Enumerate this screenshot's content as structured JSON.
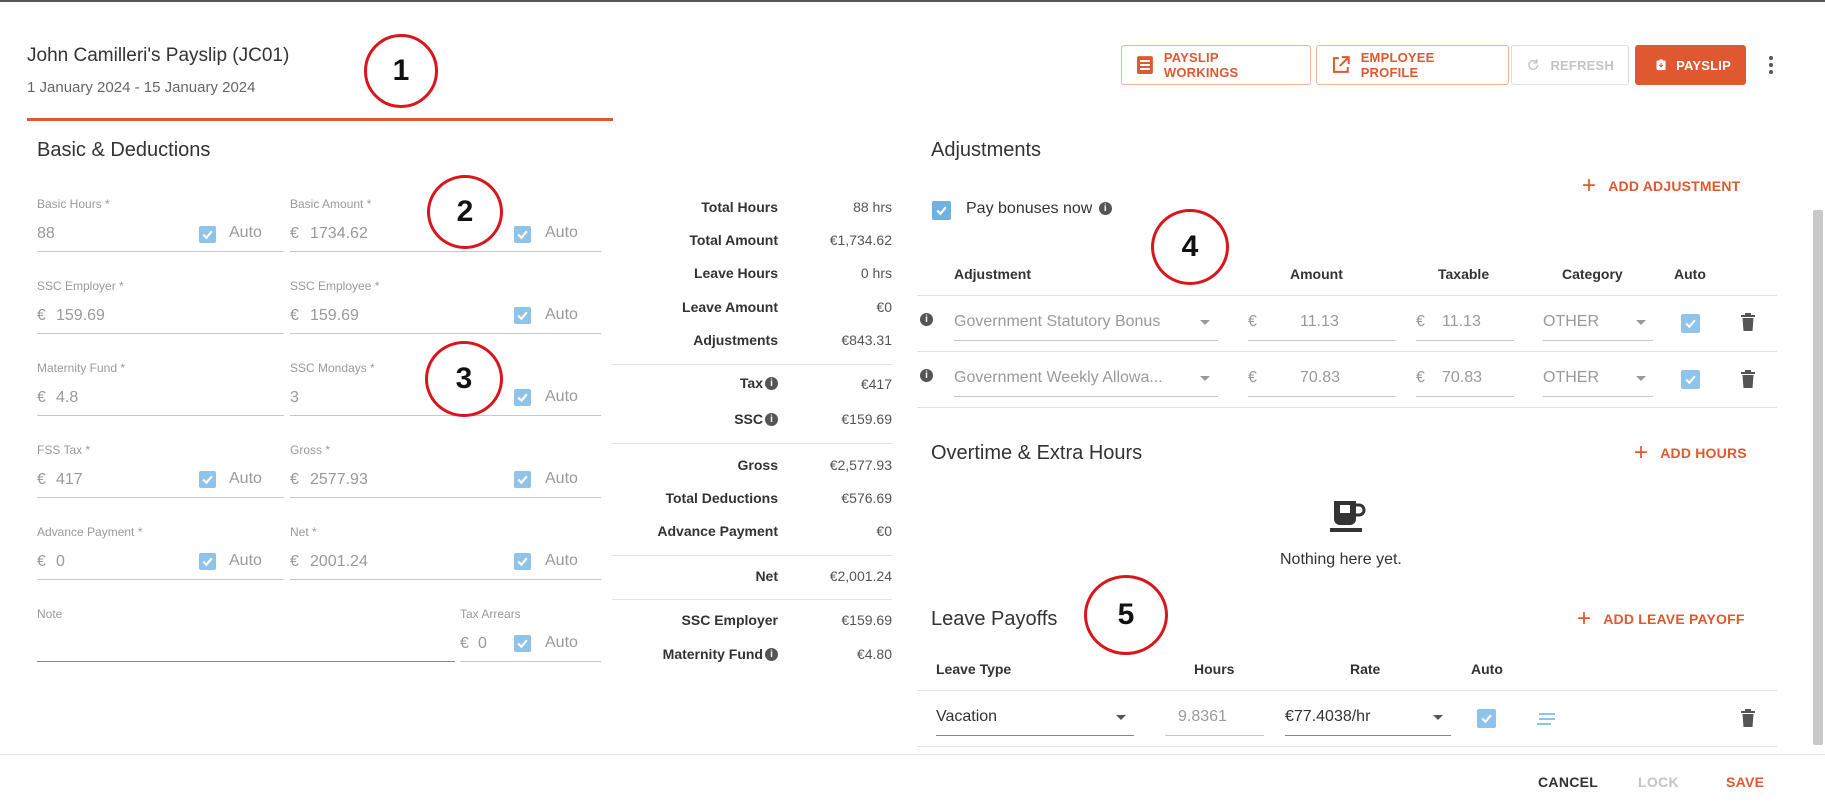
{
  "header": {
    "title": "John Camilleri's Payslip (JC01)",
    "period": "1 January 2024 - 15 January 2024",
    "buttons": {
      "workings": "PAYSLIP WORKINGS",
      "profile": "EMPLOYEE PROFILE",
      "refresh": "REFRESH",
      "payslip": "PAYSLIP"
    }
  },
  "basic": {
    "title": "Basic & Deductions",
    "auto_label": "Auto",
    "currency": "€",
    "fields": {
      "basic_hours": {
        "label": "Basic Hours *",
        "value": "88"
      },
      "basic_amount": {
        "label": "Basic Amount *",
        "value": "1734.62"
      },
      "ssc_employer": {
        "label": "SSC Employer *",
        "value": "159.69"
      },
      "ssc_employee": {
        "label": "SSC Employee *",
        "value": "159.69"
      },
      "maternity_fund": {
        "label": "Maternity Fund *",
        "value": "4.8"
      },
      "ssc_mondays": {
        "label": "SSC Mondays *",
        "value": "3"
      },
      "fss_tax": {
        "label": "FSS Tax *",
        "value": "417"
      },
      "gross": {
        "label": "Gross *",
        "value": "2577.93"
      },
      "advance_payment": {
        "label": "Advance Payment *",
        "value": "0"
      },
      "net": {
        "label": "Net *",
        "value": "2001.24"
      },
      "note": {
        "label": "Note",
        "value": ""
      },
      "tax_arrears": {
        "label": "Tax Arrears",
        "value": "0"
      }
    }
  },
  "summary": {
    "total_hours": {
      "label": "Total Hours",
      "value": "88 hrs"
    },
    "total_amount": {
      "label": "Total Amount",
      "value": "€1,734.62"
    },
    "leave_hours": {
      "label": "Leave Hours",
      "value": "0 hrs"
    },
    "leave_amount": {
      "label": "Leave Amount",
      "value": "€0"
    },
    "adjustments": {
      "label": "Adjustments",
      "value": "€843.31"
    },
    "tax": {
      "label": "Tax",
      "value": "€417"
    },
    "ssc": {
      "label": "SSC",
      "value": "€159.69"
    },
    "gross": {
      "label": "Gross",
      "value": "€2,577.93"
    },
    "total_deductions": {
      "label": "Total Deductions",
      "value": "€576.69"
    },
    "advance_payment": {
      "label": "Advance Payment",
      "value": "€0"
    },
    "net": {
      "label": "Net",
      "value": "€2,001.24"
    },
    "ssc_employer": {
      "label": "SSC Employer",
      "value": "€159.69"
    },
    "maternity_fund": {
      "label": "Maternity Fund",
      "value": "€4.80"
    }
  },
  "adjustments": {
    "title": "Adjustments",
    "add_label": "ADD ADJUSTMENT",
    "pay_bonuses_label": "Pay bonuses now",
    "columns": [
      "Adjustment",
      "Amount",
      "Taxable",
      "Category",
      "Auto"
    ],
    "rows": [
      {
        "name": "Government Statutory Bonus",
        "amount": "11.13",
        "taxable": "11.13",
        "category": "OTHER"
      },
      {
        "name": "Government Weekly Allowa...",
        "amount": "70.83",
        "taxable": "70.83",
        "category": "OTHER"
      }
    ]
  },
  "overtime": {
    "title": "Overtime & Extra Hours",
    "add_label": "ADD HOURS",
    "empty_text": "Nothing here yet."
  },
  "leave": {
    "title": "Leave Payoffs",
    "add_label": "ADD LEAVE PAYOFF",
    "columns": [
      "Leave Type",
      "Hours",
      "Rate",
      "Auto"
    ],
    "rows": [
      {
        "type": "Vacation",
        "hours": "9.8361",
        "rate": "€77.4038/hr"
      }
    ]
  },
  "footer": {
    "cancel": "CANCEL",
    "lock": "LOCK",
    "save": "SAVE"
  },
  "callouts": [
    "1",
    "2",
    "3",
    "4",
    "5"
  ],
  "colors": {
    "accent": "#e0582f",
    "checkbox": "#8ec3ea",
    "callout": "#d8161b"
  }
}
